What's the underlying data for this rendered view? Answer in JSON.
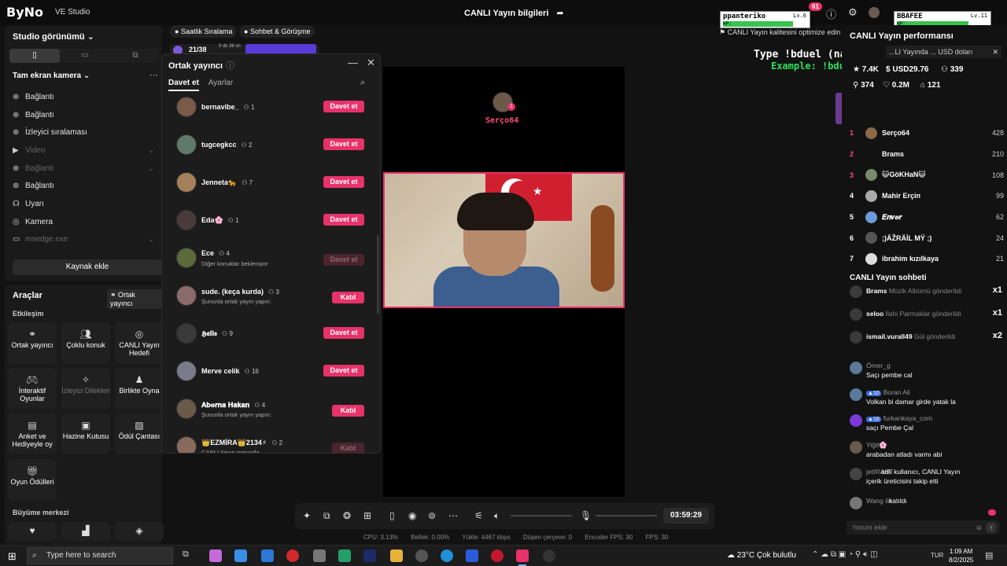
{
  "app": {
    "logo": "ByNo",
    "logo_sub": "VE Studio",
    "live_info_title": "CANLI Yayın bilgileri",
    "notif_count": "61",
    "quality_tip": "CANLI Yayın kalitesini optimize edin"
  },
  "game_overlay": {
    "player1_name": "ppanteriko",
    "player1_level": "Lv.6",
    "player2_name": "BBAFEE",
    "player2_level": "Lv.11",
    "hp_label": "HP:",
    "type_line": "Type !bduel (name) to play",
    "example_line": "Example: !bduel BBAFEE",
    "player1_hp": 0.82,
    "player2_hp": 0.78
  },
  "left_panel": {
    "studio_title": "Studio görünümü",
    "scene_title": "Tam ekran kamera",
    "sources": [
      {
        "icon": "globe-icon",
        "label": "Bağlantı",
        "dim": false
      },
      {
        "icon": "globe-icon",
        "label": "Bağlantı",
        "dim": false
      },
      {
        "icon": "globe-icon",
        "label": "İzleyici sıralaması",
        "dim": false
      },
      {
        "icon": "video-icon",
        "label": "Video",
        "dim": true
      },
      {
        "icon": "globe-icon",
        "label": "Bağlantı",
        "dim": true
      },
      {
        "icon": "globe-icon",
        "label": "Bağlantı",
        "dim": false
      },
      {
        "icon": "headset-icon",
        "label": "Uyarı",
        "dim": false
      },
      {
        "icon": "camera-icon",
        "label": "Kamera",
        "dim": false
      },
      {
        "icon": "window-icon",
        "label": "msedge.exe",
        "dim": true
      }
    ],
    "add_source_label": "Kaynak ekle"
  },
  "tools_panel": {
    "title": "Araçlar",
    "cohost_chip": "Ortak yayıncı",
    "section_engagement": "Etkileşim",
    "section_growth": "Büyüme merkezi",
    "tools": [
      {
        "label": "Ortak yayıncı",
        "icon": "link-icon",
        "dim": false
      },
      {
        "label": "Çoklu konuk",
        "icon": "users-icon",
        "dim": false
      },
      {
        "label": "CANLI Yayın Hedefi",
        "icon": "target-icon",
        "dim": false
      },
      {
        "label": "İnteraktif Oyunlar",
        "icon": "gamepad-icon",
        "dim": false
      },
      {
        "label": "İzleyici Dilekleri",
        "icon": "star-icon",
        "dim": true
      },
      {
        "label": "Birlikte Oyna",
        "icon": "person-icon",
        "dim": false
      },
      {
        "label": "Anket ve Hediyeyle oy",
        "icon": "poll-icon",
        "dim": false
      },
      {
        "label": "Hazine Kutusu",
        "icon": "chest-icon",
        "dim": false
      },
      {
        "label": "Ödül Çantası",
        "icon": "bag-icon",
        "dim": false
      },
      {
        "label": "Oyun Ödülleri",
        "icon": "gift-icon",
        "dim": false
      }
    ]
  },
  "top_chips": {
    "hourly_rank": "Saatlik Sıralama",
    "chat_match": "Sohbet & Görüşme",
    "progress_value": "21/38",
    "progress_time": "0 dk 36 sn"
  },
  "popup": {
    "title": "Ortak yayıncı",
    "tabs": [
      "Davet et",
      "Ayarlar"
    ],
    "invite_label": "Davet et",
    "join_label": "Katıl",
    "users": [
      {
        "name": "bernavibe_",
        "count": "1",
        "sub": "",
        "action": "invite",
        "disabled": false
      },
      {
        "name": "tugcegkcc",
        "count": "2",
        "sub": "",
        "action": "invite",
        "disabled": false
      },
      {
        "name": "Jenneta🐆",
        "count": "7",
        "sub": "",
        "action": "invite",
        "disabled": false
      },
      {
        "name": "Eda🌸",
        "count": "1",
        "sub": "",
        "action": "invite",
        "disabled": false
      },
      {
        "name": "Ece",
        "count": "4",
        "sub": "Diğer konuklar bekleniyor",
        "action": "invite",
        "disabled": true
      },
      {
        "name": "sude. (keça kurda)",
        "count": "3",
        "sub": "Şununla ortak yayın yapın:",
        "action": "join",
        "disabled": false
      },
      {
        "name": "𝕳𝖆𝖑𝖎𝖘",
        "count": "9",
        "sub": "",
        "action": "invite",
        "disabled": false
      },
      {
        "name": "Merve celik",
        "count": "16",
        "sub": "",
        "action": "invite",
        "disabled": false
      },
      {
        "name": "𝐀𝐛𝐞𝐫𝐧𝐚 𝐇𝐚𝐤𝐚𝐧",
        "count": "4",
        "sub": "Şununla ortak yayın yapın:",
        "action": "join",
        "disabled": false
      },
      {
        "name": "👑EZMİRA👑2134⚡",
        "count": "2",
        "sub": "CANLI Yayın maçında",
        "action": "join",
        "disabled": true
      }
    ]
  },
  "stream": {
    "overlay_name": "Serço64",
    "overlay_badge": "1"
  },
  "right_panel": {
    "perf_title": "CANLI Yayın performansı",
    "perf_notice": "...LI Yayında ... USD doları",
    "stats": {
      "likes_top": "7.4K",
      "usd": "USD29.76",
      "viewers_top": "339",
      "shares": "374",
      "hearts": "0.2M",
      "gifts": "121"
    },
    "ranking": [
      {
        "rank": "1",
        "name": "Serço64",
        "score": "428",
        "color": "#ff4d7d"
      },
      {
        "rank": "2",
        "name": "Brams",
        "score": "210",
        "color": "#ff4d7d"
      },
      {
        "rank": "3",
        "name": "😺GöKHaN😺",
        "score": "108",
        "color": "#ff4d7d"
      },
      {
        "rank": "4",
        "name": "Mahir Erçin",
        "score": "99",
        "color": "#ffffff"
      },
      {
        "rank": "5",
        "name": "𝑬𝒏𝒗𝒆𝒓",
        "score": "62",
        "color": "#ffffff"
      },
      {
        "rank": "6",
        "name": ";)ÄŽRÄİL MÝ ;)",
        "score": "24",
        "color": "#ffffff"
      },
      {
        "rank": "7",
        "name": "ibrahim kızılkaya",
        "score": "21",
        "color": "#ffffff"
      }
    ],
    "chat_title": "CANLI Yayın sohbeti",
    "gifts": [
      {
        "user": "Brams",
        "text": "Müzik Albümü gönderildi",
        "mult": "x1"
      },
      {
        "user": "seloo",
        "text": "İlahi Parmaklar gönderildi",
        "mult": "x1"
      },
      {
        "user": "ismail.vurall49",
        "text": "Gül gönderildi",
        "mult": "x2"
      }
    ],
    "messages": [
      {
        "user": "Ömer_g",
        "badge": "",
        "text": "Saçı pembe cal"
      },
      {
        "user": "Boran Ali",
        "badge": "10",
        "text": "Volkan bi damar girde yatak la"
      },
      {
        "user": "furkankaya_com",
        "badge": "10",
        "text": "saçı Pembe Çal"
      },
      {
        "user": "Yiğit🌸",
        "badge": "",
        "text": "arabadan atladı varmı abi"
      },
      {
        "user": "jettRANT",
        "badge": "",
        "text": "adlı kullanıcı, CANLI Yayın"
      },
      {
        "user": "",
        "badge": "",
        "text": "içerik üreticisini takip etti"
      },
      {
        "user": "Wang lin",
        "badge": "",
        "text": "katıldı"
      }
    ],
    "comment_placeholder": "Yorum ekle"
  },
  "controls": {
    "timer": "03:59:29",
    "status": {
      "cpu": "CPU: 3.13%",
      "memory": "Bellek: 0.00%",
      "upload": "Yükle: 4467 kbps",
      "dropped": "Düşen çerçeve: 0",
      "encoder_fps": "Encoder FPS: 30",
      "fps": "FPS: 30"
    }
  },
  "taskbar": {
    "search_placeholder": "Type here to search",
    "weather": "23°C  Çok bulutlu",
    "lang": "TUR",
    "time": "1:09 AM",
    "date": "8/2/2025"
  }
}
